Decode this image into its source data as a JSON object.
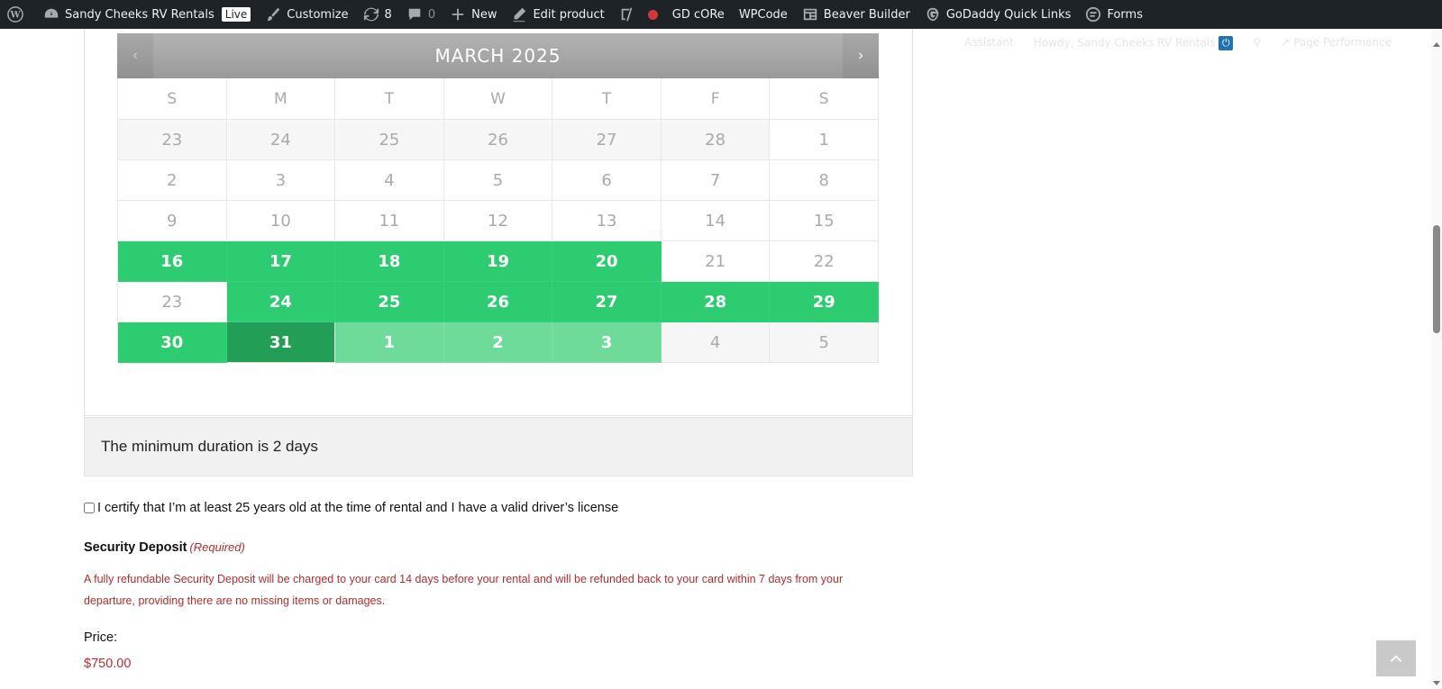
{
  "adminbar": {
    "site_name": "Sandy Cheeks RV Rentals",
    "live_badge": "Live",
    "customize": "Customize",
    "updates_count": "8",
    "comments_count": "0",
    "new": "New",
    "edit_product": "Edit product",
    "gd_core": "GD cORe",
    "wpcode": "WPCode",
    "beaver_builder": "Beaver Builder",
    "godaddy_links": "GoDaddy Quick Links",
    "forms": "Forms"
  },
  "secondary": {
    "assistant": "Assistant",
    "howdy": "Howdy, Sandy Cheeks RV Rentals",
    "page_performance": "Page Performance"
  },
  "calendar": {
    "title": "MARCH 2025",
    "prev": "‹",
    "next": "›",
    "weekdays": [
      "S",
      "M",
      "T",
      "W",
      "T",
      "F",
      "S"
    ],
    "days": [
      {
        "d": "23",
        "s": "muted-bg"
      },
      {
        "d": "24",
        "s": "muted-bg"
      },
      {
        "d": "25",
        "s": "muted-bg"
      },
      {
        "d": "26",
        "s": "muted-bg"
      },
      {
        "d": "27",
        "s": "muted-bg"
      },
      {
        "d": "28",
        "s": "muted-bg"
      },
      {
        "d": "1",
        "s": ""
      },
      {
        "d": "2",
        "s": ""
      },
      {
        "d": "3",
        "s": ""
      },
      {
        "d": "4",
        "s": ""
      },
      {
        "d": "5",
        "s": ""
      },
      {
        "d": "6",
        "s": ""
      },
      {
        "d": "7",
        "s": ""
      },
      {
        "d": "8",
        "s": ""
      },
      {
        "d": "9",
        "s": ""
      },
      {
        "d": "10",
        "s": ""
      },
      {
        "d": "11",
        "s": ""
      },
      {
        "d": "12",
        "s": ""
      },
      {
        "d": "13",
        "s": ""
      },
      {
        "d": "14",
        "s": ""
      },
      {
        "d": "15",
        "s": ""
      },
      {
        "d": "16",
        "s": "sel"
      },
      {
        "d": "17",
        "s": "sel"
      },
      {
        "d": "18",
        "s": "sel"
      },
      {
        "d": "19",
        "s": "sel"
      },
      {
        "d": "20",
        "s": "sel"
      },
      {
        "d": "21",
        "s": ""
      },
      {
        "d": "22",
        "s": ""
      },
      {
        "d": "23",
        "s": "gap"
      },
      {
        "d": "24",
        "s": "sel"
      },
      {
        "d": "25",
        "s": "sel"
      },
      {
        "d": "26",
        "s": "sel"
      },
      {
        "d": "27",
        "s": "sel"
      },
      {
        "d": "28",
        "s": "sel"
      },
      {
        "d": "29",
        "s": "sel"
      },
      {
        "d": "30",
        "s": "sel"
      },
      {
        "d": "31",
        "s": "active"
      },
      {
        "d": "1",
        "s": "light"
      },
      {
        "d": "2",
        "s": "light"
      },
      {
        "d": "3",
        "s": "light"
      },
      {
        "d": "4",
        "s": "muted-bg"
      },
      {
        "d": "5",
        "s": "muted-bg"
      }
    ]
  },
  "notice": {
    "min_duration": "The minimum duration is 2 days"
  },
  "certify": {
    "label": "I certify that I’m at least 25 years old at the time of rental and I have a valid driver’s license"
  },
  "deposit": {
    "title": "Security Deposit",
    "required": "(Required)",
    "description": "A fully refundable Security Deposit will be charged to your card 14 days before your rental and will be refunded back to your card within 7 days from your departure, providing there are no missing items or damages."
  },
  "price": {
    "label": "Price:",
    "value": "$750.00"
  },
  "colors": {
    "selected": "#2ecc71",
    "active": "#239e57",
    "light": "#6fdb9a",
    "required_text": "#b32d2e"
  }
}
